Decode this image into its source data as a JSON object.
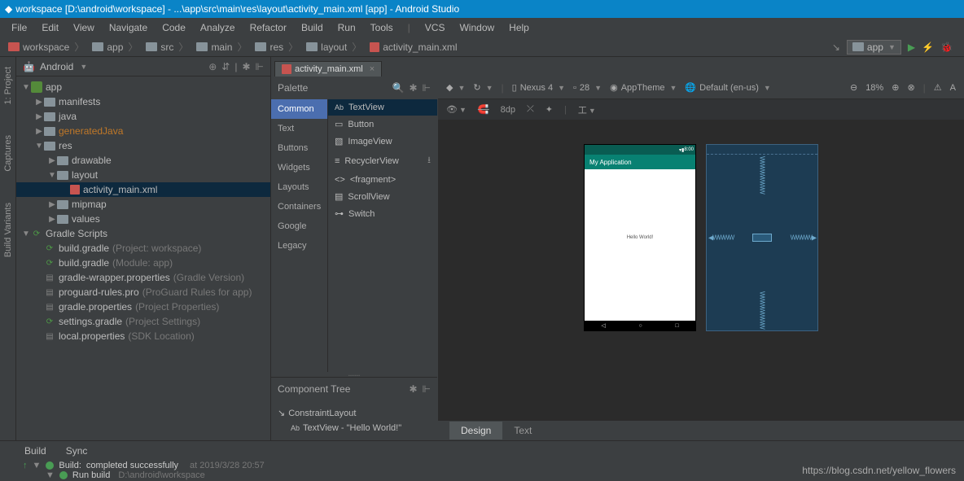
{
  "title": "workspace [D:\\android\\workspace] - ...\\app\\src\\main\\res\\layout\\activity_main.xml [app] - Android Studio",
  "menu": [
    "File",
    "Edit",
    "View",
    "Navigate",
    "Code",
    "Analyze",
    "Refactor",
    "Build",
    "Run",
    "Tools",
    "VCS",
    "Window",
    "Help"
  ],
  "breadcrumbs": [
    "workspace",
    "app",
    "src",
    "main",
    "res",
    "layout",
    "activity_main.xml"
  ],
  "nav_right": {
    "config": "app"
  },
  "project_view": {
    "mode": "Android"
  },
  "tree": {
    "app": "app",
    "manifests": "manifests",
    "java": "java",
    "generatedJava": "generatedJava",
    "res": "res",
    "drawable": "drawable",
    "layout": "layout",
    "activity_main": "activity_main.xml",
    "mipmap": "mipmap",
    "values": "values",
    "gradle_scripts": "Gradle Scripts",
    "build_gradle_ws": "build.gradle",
    "build_gradle_ws_hint": "(Project: workspace)",
    "build_gradle_app": "build.gradle",
    "build_gradle_app_hint": "(Module: app)",
    "gradle_wrapper": "gradle-wrapper.properties",
    "gradle_wrapper_hint": "(Gradle Version)",
    "proguard": "proguard-rules.pro",
    "proguard_hint": "(ProGuard Rules for app)",
    "gradle_props": "gradle.properties",
    "gradle_props_hint": "(Project Properties)",
    "settings_gradle": "settings.gradle",
    "settings_gradle_hint": "(Project Settings)",
    "local_props": "local.properties",
    "local_props_hint": "(SDK Location)"
  },
  "left_strip": [
    "1: Project",
    "Captures",
    "Build Variants"
  ],
  "editor_tab": "activity_main.xml",
  "palette": {
    "title": "Palette",
    "categories": [
      "Common",
      "Text",
      "Buttons",
      "Widgets",
      "Layouts",
      "Containers",
      "Google",
      "Legacy"
    ],
    "items": [
      "TextView",
      "Button",
      "ImageView",
      "RecyclerView",
      "<fragment>",
      "ScrollView",
      "Switch"
    ]
  },
  "component_tree": {
    "title": "Component Tree",
    "root": "ConstraintLayout",
    "child": "TextView - \"Hello World!\""
  },
  "design_toolbar": {
    "device": "Nexus 4",
    "api": "28",
    "theme": "AppTheme",
    "locale": "Default (en-us)",
    "zoom": "18%"
  },
  "subtoolbar": {
    "dp": "8dp"
  },
  "device": {
    "status_time": "8:00",
    "app_title": "My Application",
    "hello": "Hello World!"
  },
  "tabs": {
    "design": "Design",
    "text": "Text"
  },
  "bottom": {
    "build_tab": "Build",
    "sync_tab": "Sync",
    "build_result": "Build:",
    "build_status": "completed successfully",
    "build_time": "at 2019/3/28 20:57",
    "run_build": "Run build",
    "run_build_path": "D:\\android\\workspace"
  },
  "watermark": "https://blog.csdn.net/yellow_flowers"
}
